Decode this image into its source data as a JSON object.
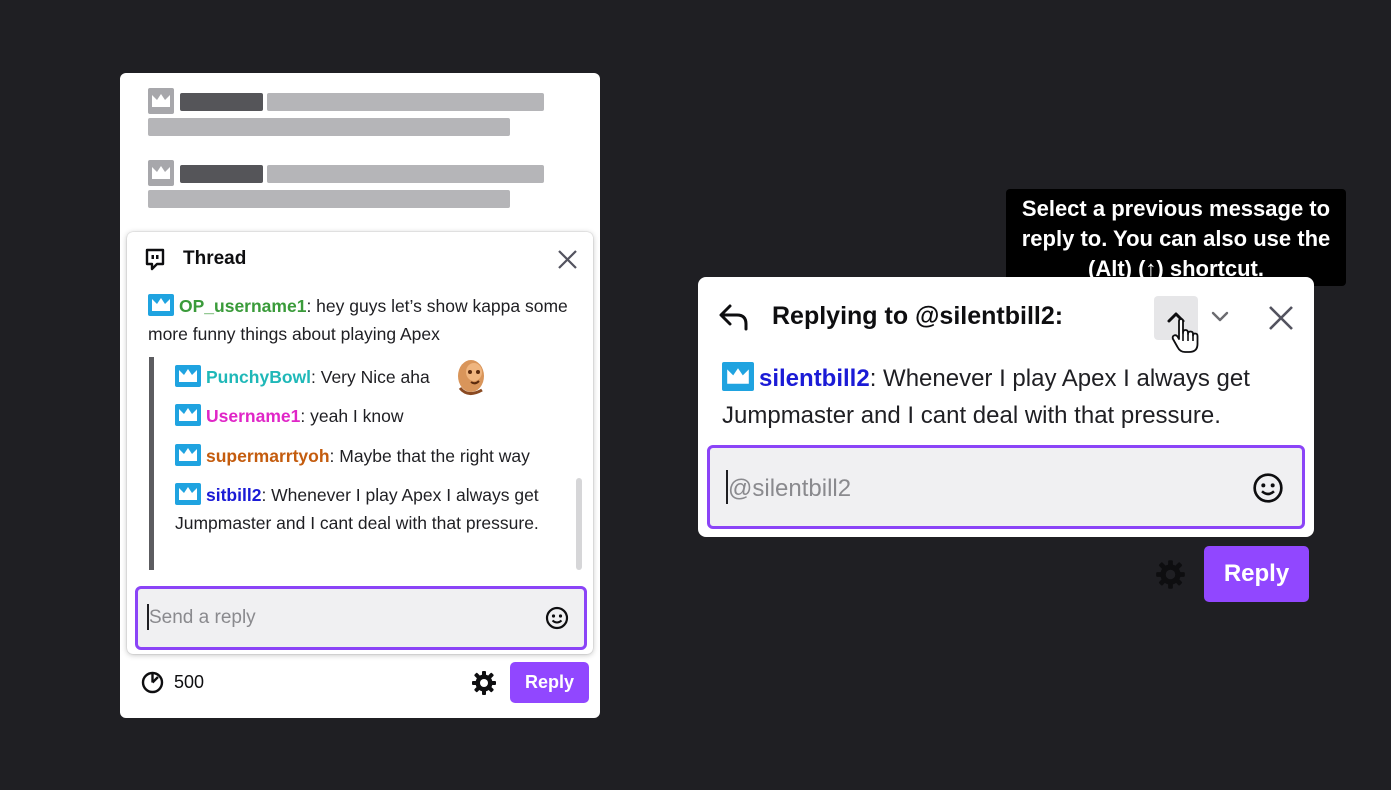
{
  "thread": {
    "title": "Thread",
    "op": {
      "username": "OP_username1",
      "username_color": "#3a9b3a",
      "text": ": hey guys let’s show kappa some more funny things about playing Apex"
    },
    "replies": [
      {
        "username": "PunchyBowl",
        "username_color": "#1fb8b8",
        "text": ": Very Nice aha",
        "emote": true
      },
      {
        "username": "Username1",
        "username_color": "#e026c7",
        "text": ": yeah I know"
      },
      {
        "username": "supermarrtyoh",
        "username_color": "#c45c0e",
        "text": ": Maybe that the right way"
      },
      {
        "username": "sitbill2",
        "username_color": "#1b1bd6",
        "text": ": Whenever I play Apex I always get Jumpmaster and I cant deal with that pressure."
      }
    ],
    "input_placeholder": "Send a reply",
    "char_count": "500",
    "reply_button": "Reply"
  },
  "reply_card": {
    "title": "Replying to @silentbill2:",
    "message": {
      "username": "silentbill2",
      "username_color": "#1b1bd6",
      "text": ": Whenever I play Apex I always get Jumpmaster and I cant deal with that pressure."
    },
    "input_placeholder": "@silentbill2",
    "reply_button": "Reply",
    "tooltip": "Select a previous message to reply to. You can also use the (Alt) (↑) shortcut."
  },
  "colors": {
    "accent": "#9147ff",
    "input_border": "#8b44f7",
    "badge": "#1fa3e0",
    "background": "#1f1f23"
  }
}
